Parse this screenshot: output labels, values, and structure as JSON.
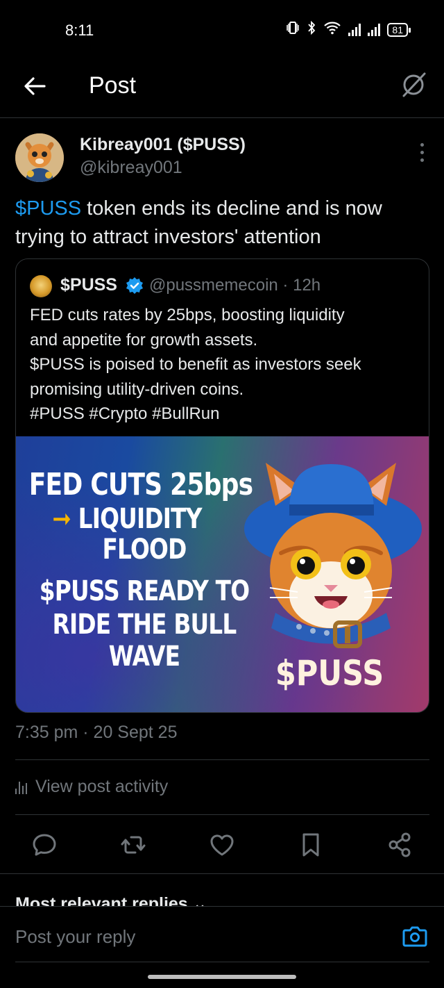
{
  "status_bar": {
    "time": "8:11",
    "battery": "81"
  },
  "header": {
    "title": "Post"
  },
  "post": {
    "author_name": "Kibreay001 ($PUSS)",
    "author_handle": "@kibreay001",
    "text_cashtag": "$PUSS",
    "text_rest": " token ends its decline and is now trying to attract investors' attention",
    "timestamp": "7:35 pm · 20 Sept 25"
  },
  "quoted_post": {
    "name": "$PUSS",
    "handle_time": "@pussmemecoin · 12h",
    "lines": [
      "FED cuts rates by 25bps, boosting liquidity",
      "and appetite for growth assets.",
      "$PUSS is poised to benefit as investors seek",
      "promising utility-driven coins.",
      "#PUSS #Crypto #BullRun"
    ],
    "image": {
      "line1": "FED CUTS 25bps",
      "line2_arrow": "➞",
      "line2": " LIQUIDITY",
      "line3": "FLOOD",
      "line4": "$PUSS READY TO",
      "line5": "RIDE THE BULL",
      "line6": "WAVE",
      "brand": "$PUSS"
    }
  },
  "activity": {
    "label": "View post activity"
  },
  "replies": {
    "sort_label": "Most relevant replies ⌄"
  },
  "reply_bar": {
    "placeholder": "Post your reply"
  },
  "colors": {
    "accent": "#1d9bf0",
    "muted": "#71767b",
    "border": "#2f3336",
    "background": "#000000"
  }
}
